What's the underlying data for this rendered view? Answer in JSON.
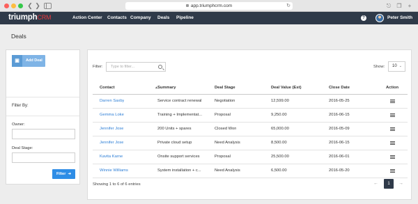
{
  "browser": {
    "url": "app.triumphcrm.com"
  },
  "app": {
    "logo_main": "triumph",
    "logo_suffix": "CRM",
    "nav": [
      "Action Center",
      "Contacts",
      "Company",
      "Deals",
      "Pipeline"
    ],
    "help_label": "?",
    "user_name": "Peter Smith"
  },
  "page": {
    "title": "Deals"
  },
  "sidebar": {
    "add_deal_label": "Add Deal",
    "filter_by_label": "Filter By:",
    "owner_label": "Owner:",
    "owner_value": "",
    "deal_stage_label": "Deal Stage:",
    "deal_stage_value": "",
    "filter_button_label": "Filter"
  },
  "table": {
    "filter_label": "Filter:",
    "filter_placeholder": "Type to filter...",
    "show_label": "Show:",
    "show_value": "10",
    "columns": [
      "Contact",
      "Summary",
      "Deal Stage",
      "Deal Value (Est)",
      "Close Date",
      "Action"
    ],
    "rows": [
      {
        "contact": "Darren Saxby",
        "summary": "Service contract renewal",
        "stage": "Negotiation",
        "value": "12,599.00",
        "close_date": "2016-05-25"
      },
      {
        "contact": "Gemma Loke",
        "summary": "Training + Implementat...",
        "stage": "Proposal",
        "value": "9,250.00",
        "close_date": "2016-06-15"
      },
      {
        "contact": "Jennifer Jose",
        "summary": "200 Units + spares",
        "stage": "Closed Won",
        "value": "65,000.00",
        "close_date": "2016-05-09"
      },
      {
        "contact": "Jennifer Jose",
        "summary": "Private cloud setup",
        "stage": "Need Analysis",
        "value": "8,500.00",
        "close_date": "2016-06-15"
      },
      {
        "contact": "Kavita Karne",
        "summary": "Onsite support services",
        "stage": "Proposal",
        "value": "25,500.00",
        "close_date": "2016-06-01"
      },
      {
        "contact": "Winnie Williams",
        "summary": "System installation + c...",
        "stage": "Need Analysis",
        "value": "6,500.00",
        "close_date": "2016-05-20"
      }
    ],
    "entries_text": "Showing 1 to 6 of 6 entries",
    "current_page": "1"
  },
  "icons": {
    "add_deal": "briefcase-icon",
    "filter_button": "arrow-right-icon",
    "search": "search-icon",
    "row_action": "hamburger-menu-icon",
    "sort": "sort-asc-icon"
  },
  "colors": {
    "nav_bg": "#2f3a49",
    "accent": "#2e8de6",
    "logo_crm": "#e8383d",
    "link": "#2e7fd6"
  }
}
